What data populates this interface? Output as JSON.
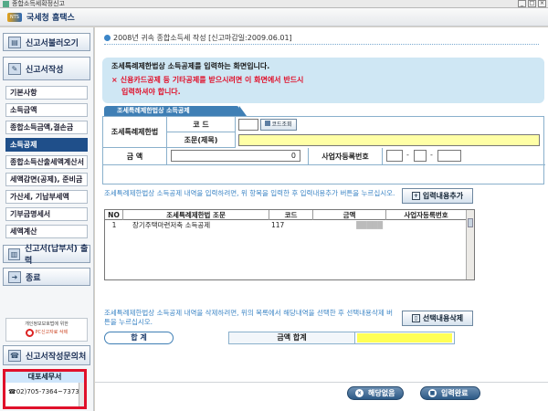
{
  "window": {
    "title": "종합소득세확정신고"
  },
  "brand": {
    "logo_text": "NTS",
    "name": "국세청 홈택스"
  },
  "sidebar": {
    "sections": [
      {
        "label": "신고서불러오기",
        "icon": "folder-icon"
      },
      {
        "label": "신고서작성",
        "icon": "pencil-icon"
      },
      {
        "label": "신고서(납부서) 출력",
        "icon": "printer-icon"
      },
      {
        "label": "종료",
        "icon": "exit-icon"
      },
      {
        "label": "신고서작성문의처",
        "icon": "phone-icon"
      }
    ],
    "items": [
      {
        "label": "기본사항"
      },
      {
        "label": "소득금액"
      },
      {
        "label": "종합소득금액,결손금"
      },
      {
        "label": "소득공제"
      },
      {
        "label": "종합소득산출세액계산서"
      },
      {
        "label": "세액감면(공제), 준비금"
      },
      {
        "label": "가산세, 기납부세액"
      },
      {
        "label": "기부금명세서"
      },
      {
        "label": "세액계산"
      }
    ],
    "active_item": "소득공제",
    "privacy": {
      "line1": "개인정보보호법에 위한",
      "link": "PC신고자료 삭제"
    },
    "tax_office": {
      "header": "대포세무서",
      "phone": "☎02)705-7364~7373"
    }
  },
  "main": {
    "page_title": "2008년 귀속 종합소득세 작성 [신고마감일:2009.06.01]",
    "notice": {
      "line1": "조세특례제한법상 소득공제를 입력하는 화면입니다.",
      "line2": "신용카드공제 등 기타공제를 받으시려면 이 화면에서 반드시",
      "line3": "입력하셔야 합니다."
    },
    "section_tab": "조세특례제한법상 소득공제",
    "form": {
      "law_label": "조세특례제한법",
      "code_label": "코 드",
      "code_value": "",
      "code_search_button": "코드조회",
      "clause_label": "조문(제목)",
      "clause_value": "",
      "amount_label": "금    액",
      "amount_value": "0",
      "biz_no_label": "사업자등록번호",
      "biz_no_1": "",
      "biz_no_2": "",
      "biz_no_3": ""
    },
    "guide_add": "조세특례제한법상 소득공제 내역을 입력하려면, 위 항목을 입력한 후 입력내용추가 버튼을 누르십시오.",
    "add_button": "입력내용추가",
    "table": {
      "columns": [
        "NO",
        "조세특례제한법 조문",
        "코드",
        "금액",
        "사업자등록번호"
      ],
      "rows": [
        {
          "no": "1",
          "name": "장기주택마련저축 소득공제",
          "code": "117",
          "amount": "█████",
          "biz": ""
        }
      ]
    },
    "guide_delete": "조세특례제한법상 소득공제 내역을 삭제하려면, 위의 목록에서 해당내역을 선택한 후 선택내용삭제 버튼을 누르십시오.",
    "delete_button": "선택내용삭제",
    "total_label": "합 계",
    "amount_total_label": "금액 합계",
    "amount_total_value": "",
    "buttons": {
      "none": "해당없음",
      "done": "입력완료"
    }
  },
  "colors": {
    "accent": "#3f7fb5",
    "notice_bg": "#cfe7f4",
    "alert_red": "#e0102a",
    "highlight_yellow": "#ffff55"
  }
}
